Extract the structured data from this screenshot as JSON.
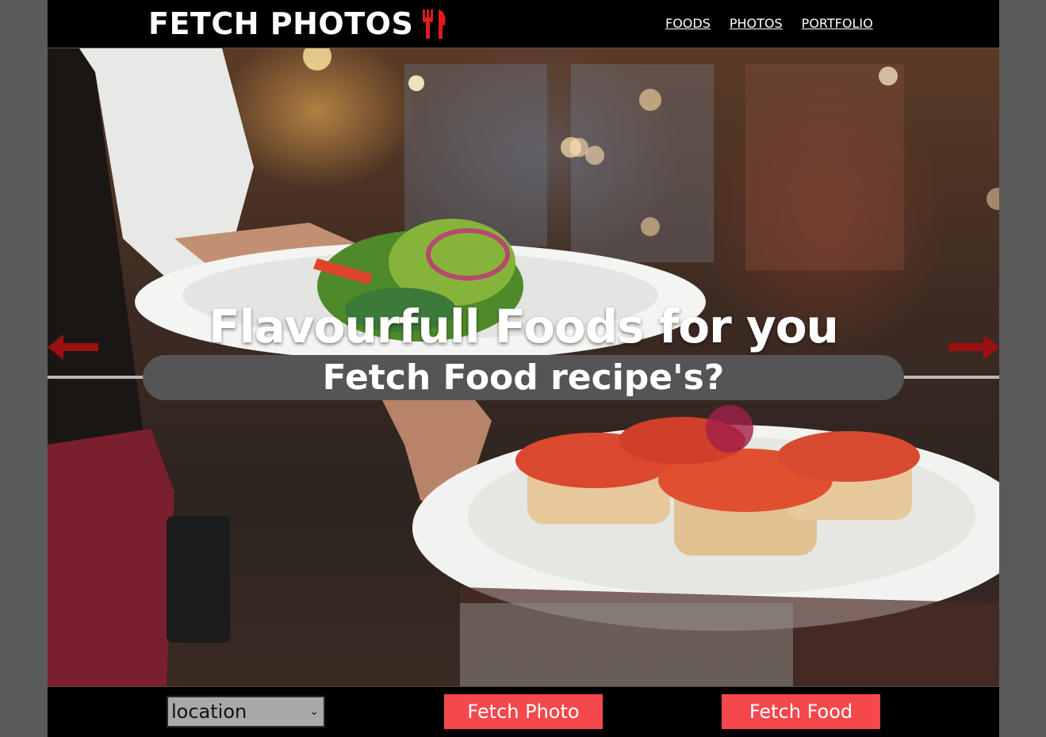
{
  "header": {
    "logo_text": "FETCH PHOTOS",
    "logo_icon": "utensils-icon",
    "nav": [
      {
        "label": "FOODS"
      },
      {
        "label": "PHOTOS"
      },
      {
        "label": "PORTFOLIO"
      }
    ]
  },
  "hero": {
    "title": "Flavourfull Foods for you",
    "search_text": "Fetch Food recipe's?",
    "prev_icon": "arrow-left-icon",
    "next_icon": "arrow-right-icon"
  },
  "controls": {
    "location_select": {
      "selected": "location"
    },
    "fetch_photo_label": "Fetch Photo",
    "fetch_food_label": "Fetch Food"
  },
  "colors": {
    "accent": "#f4484d",
    "icon_red": "#e01b1b",
    "arrow_red": "#9b1010",
    "pill": "#555555",
    "background": "#5a5a5a"
  }
}
